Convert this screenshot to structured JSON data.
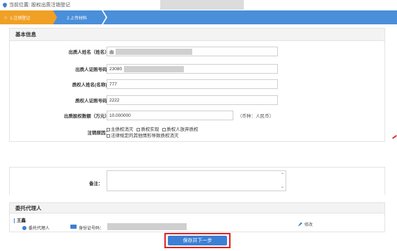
{
  "breadcrumb": {
    "text": "当前位置: 股权出质注销登记"
  },
  "steps": [
    {
      "label": "1.注销登记",
      "active": true
    },
    {
      "label": "2.上传材料",
      "active": false
    }
  ],
  "basic_info": {
    "title": "基本信息",
    "fields": [
      {
        "label": "出质人姓名（姓名）：",
        "value": "曲"
      },
      {
        "label": "出质人证照号码：",
        "value": "23080"
      },
      {
        "label": "质权人姓名(名称)：",
        "value": "777"
      },
      {
        "label": "质权人证照号码：",
        "value": "2222"
      },
      {
        "label": "出质股权数额（万元）：",
        "value": "10.000000"
      }
    ],
    "unit": "（币种：人民币）",
    "reason": {
      "label": "注销原因：",
      "options": [
        "主债权消灭",
        "质权实现",
        "质权人放弃质权",
        "法律规定的其他情形导致质权消灭"
      ]
    }
  },
  "remark": {
    "label": "备注："
  },
  "agent": {
    "title": "委托代理人",
    "name": "王鑫",
    "role": "委托代理人",
    "id_label": "身份证号码：",
    "edit_label": "修改"
  },
  "actions": {
    "save_label": "保存并下一步"
  },
  "colors": {
    "accent": "#3d7fd4",
    "step_active": "#f0a024",
    "highlight": "#e02020"
  }
}
